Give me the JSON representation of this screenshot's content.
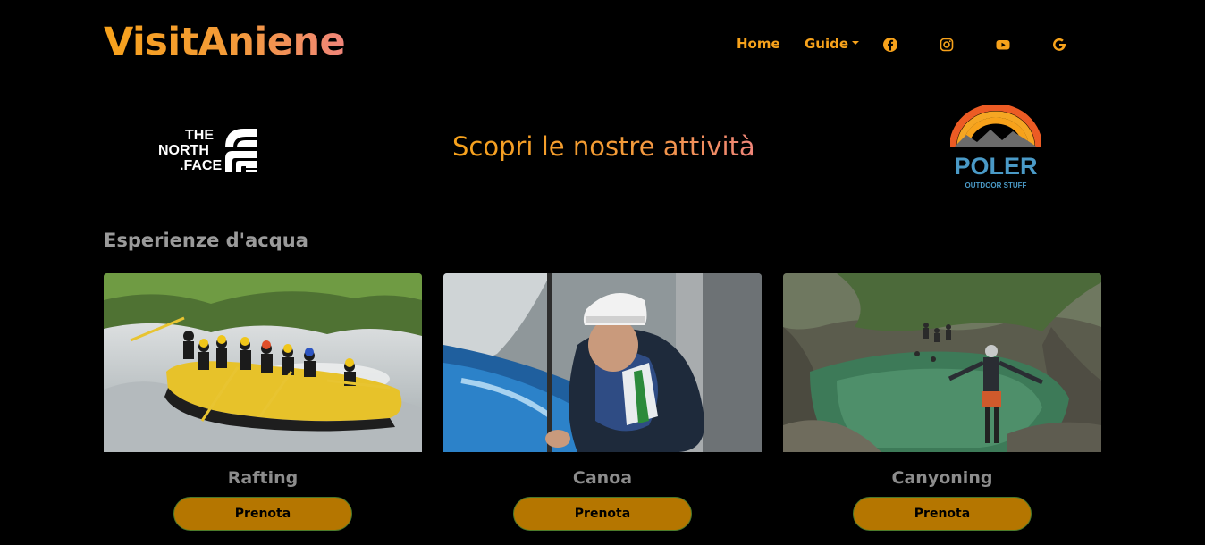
{
  "brand": {
    "name": "VisitAniene"
  },
  "nav": {
    "home": "Home",
    "guide": "Guide",
    "social": [
      "facebook-icon",
      "instagram-icon",
      "youtube-icon",
      "google-icon"
    ]
  },
  "hero": {
    "title": "Scopri le nostre attività"
  },
  "logos": {
    "left": {
      "line1": "THE",
      "line2": "NORTH",
      "line3": ".FACE"
    },
    "right": {
      "name": "POLER",
      "tagline": "OUTDOOR STUFF"
    }
  },
  "section": {
    "title": "Esperienze d'acqua"
  },
  "activities": [
    {
      "title": "Rafting",
      "button": "Prenota"
    },
    {
      "title": "Canoa",
      "button": "Prenota"
    },
    {
      "title": "Canyoning",
      "button": "Prenota"
    }
  ],
  "colors": {
    "accent": "#f7a21b",
    "button": "#b57600",
    "background": "#000000"
  }
}
